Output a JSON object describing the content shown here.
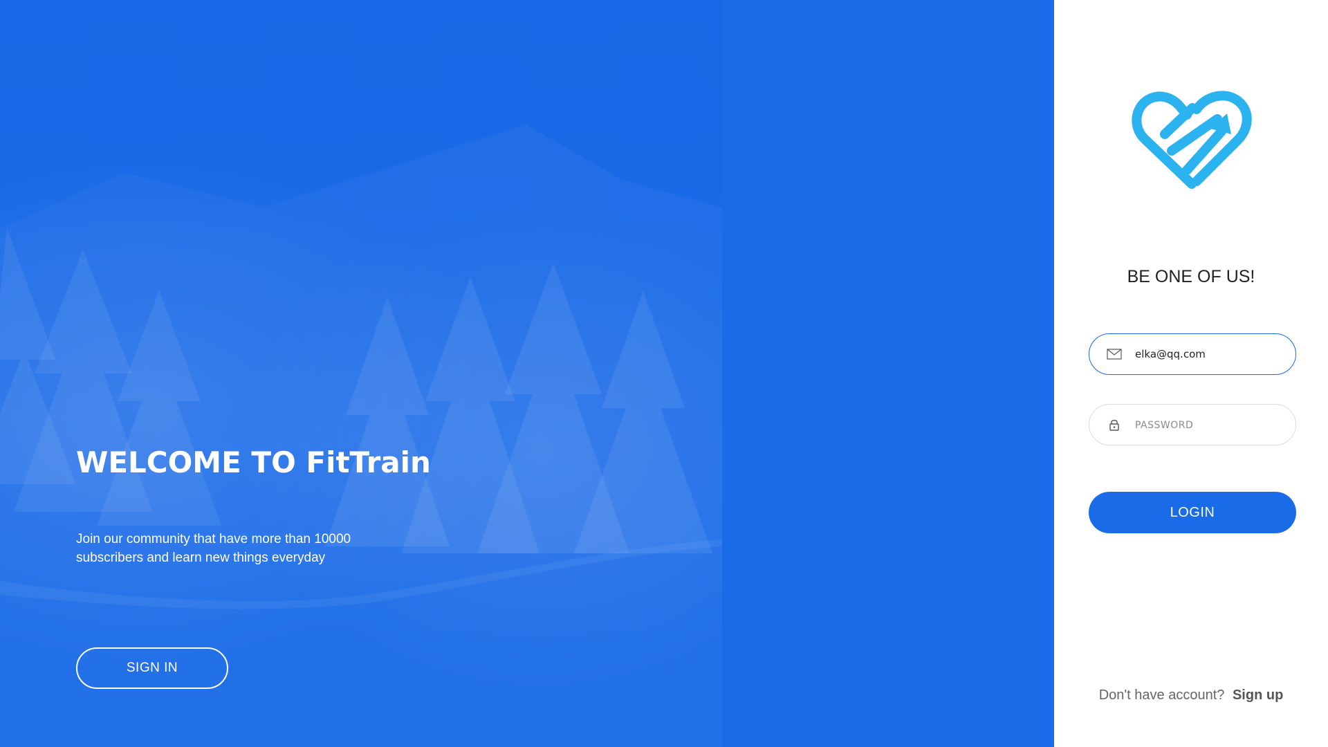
{
  "colors": {
    "primary": "#1a6be8",
    "logo": "#2bb3ef",
    "panel_bg": "#ffffff",
    "muted_text": "#666666"
  },
  "hero": {
    "title": "WELCOME TO FitTrain",
    "subtitle": "Join our community that have more than 10000 subscribers and learn new things everyday",
    "signin_label": "SIGN IN"
  },
  "login": {
    "logo_icon": "heart-arrow-logo-icon",
    "heading": "BE ONE OF US!",
    "email": {
      "icon": "envelope-icon",
      "value": "elka@qq.com"
    },
    "password": {
      "icon": "lock-icon",
      "placeholder": "PASSWORD",
      "value": ""
    },
    "login_label": "LOGIN",
    "signup_prompt": "Don't have account?",
    "signup_link": "Sign up"
  }
}
